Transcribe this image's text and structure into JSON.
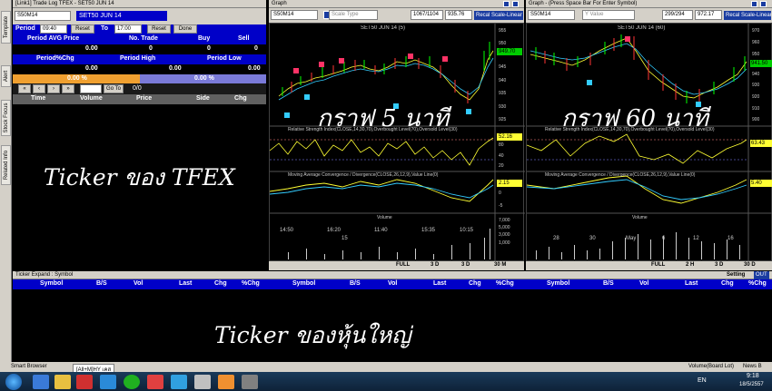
{
  "sidebar": {
    "tabs": [
      "Template",
      "Alert",
      "Stock Focus",
      "Related Info"
    ]
  },
  "left_panel": {
    "title": "[Link1] Trade Log TFEX - SET50 JUN 14",
    "symbol": "S50M14",
    "symbol_desc": "SET50 JUN 14",
    "period_label": "Period",
    "from_time": "09:40",
    "reset1": "Reset",
    "to_label": "To",
    "to_time": "17:00",
    "reset2": "Reset",
    "done": "Done",
    "row1_headers": [
      "Period AVG Price",
      "No. Trade",
      "Buy",
      "Sell"
    ],
    "row1_values": [
      "0.00",
      "0",
      "0",
      "0"
    ],
    "row2_headers": [
      "Period%Chg",
      "Period High",
      "Period Low"
    ],
    "row2_values": [
      "0.00",
      "0.00",
      "0.00"
    ],
    "pct_left": "0.00 %",
    "pct_right": "0.00 %",
    "goto_label": "Go To",
    "page": "0/0",
    "table_headers": [
      "Time",
      "Volume",
      "Price",
      "Side",
      "Chg"
    ],
    "caption": "Ticker ของ TFEX"
  },
  "graph5": {
    "title": "Graph",
    "symbol": "S50M14",
    "scale_type": "Scale Type",
    "counter": "1067/1104",
    "scale_val": "935.76",
    "recalc": "Recal Scale-Linear",
    "chart_title": "SET50 JUN 14 (5)",
    "y_labels": [
      "955",
      "950",
      "945",
      "940",
      "935",
      "930",
      "925"
    ],
    "price_tag": "949.70",
    "rsi_label": "Relative Strength Index(CLOSE,14,30,70),Overbought Level(70),Oversold Level(30)",
    "rsi_y": [
      "80",
      "40",
      "20"
    ],
    "rsi_tag": "52.16",
    "macd_label": "Moving Average Convergence / Divergence(CLOSE,26,12,9),Value Line(0)",
    "macd_y": [
      "2.5",
      "0",
      "-5"
    ],
    "macd_tag": "2.15",
    "vol_label": "Volume",
    "vol_y": [
      "7,000",
      "5,000",
      "3,000",
      "1,000"
    ],
    "x_labels": [
      "14:50",
      "16:20",
      "11:40",
      "15:35",
      "10:15"
    ],
    "x_date": "15",
    "tb_items": [
      "FULL",
      "3 D",
      "3 D",
      "30 M"
    ],
    "caption": "กราฟ 5 นาที"
  },
  "graph60": {
    "title": "Graph - (Press Space Bar For Enter Symbol)",
    "symbol": "S50M14",
    "y_value": "Y Value",
    "counter": "299/294",
    "scale_val": "972.17",
    "recalc": "Recal Scale-Linear",
    "chart_title": "SET50 JUN 14 (60)",
    "y_labels": [
      "970",
      "960",
      "950",
      "940",
      "930",
      "920",
      "910",
      "900"
    ],
    "price_tag": "941.50",
    "rsi_label": "Relative Strength Index(CLOSE,14,30,70),Overbought Level(70),Oversold Level(30)",
    "rsi_tag": "63.43",
    "macd_label": "Moving Average Convergence / Divergence(CLOSE,26,12,9),Value Line(0)",
    "macd_tag": "5.40",
    "vol_label": "Volume",
    "x_labels": [
      "28",
      "30",
      "May",
      "6",
      "12",
      "16"
    ],
    "tb_items": [
      "FULL",
      "2 H",
      "3 D",
      "30 D"
    ],
    "caption": "กราฟ 60 นาที"
  },
  "ticker": {
    "title": "Ticker Expand : Symbol",
    "setting": "Setting",
    "out": "OUT",
    "headers": [
      "Symbol",
      "B/S",
      "Vol",
      "Last",
      "Chg",
      "%Chg",
      "Symbol",
      "B/S",
      "Vol",
      "Last",
      "Chg",
      "%Chg",
      "Symbol",
      "B/S",
      "Vol",
      "Last",
      "Chg",
      "%Chg"
    ],
    "caption": "Ticker ของหุ้นใหญ่"
  },
  "statusbar": {
    "smart_browser": "Smart Browser",
    "tab": "[All+M]HY เคส",
    "volume": "Volume(Board Lot)",
    "news": "News B"
  },
  "taskbar": {
    "lang": "EN",
    "time": "9:18",
    "date": "18/5/2557"
  }
}
